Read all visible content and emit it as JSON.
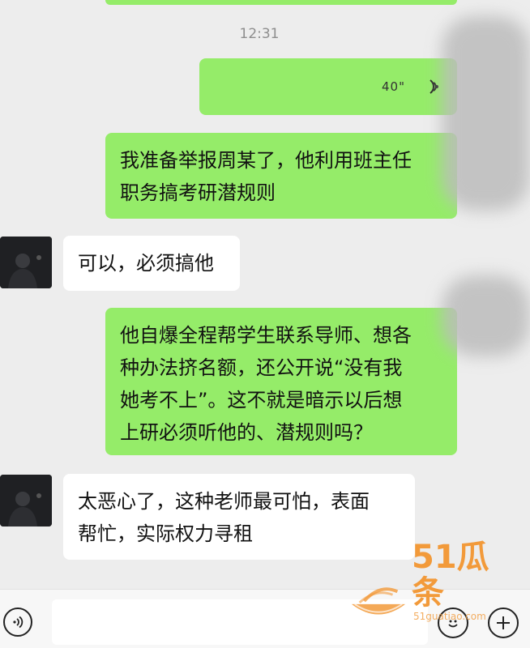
{
  "chat": {
    "timestamp": "12:31",
    "messages": [
      {
        "side": "me",
        "type": "voice",
        "duration": "40\""
      },
      {
        "side": "me",
        "type": "text",
        "text": "我准备举报周某了，他利用班主任\n职务搞考研潜规则"
      },
      {
        "side": "them",
        "type": "text",
        "text": "可以，必须搞他"
      },
      {
        "side": "me",
        "type": "text",
        "text": "他自爆全程帮学生联系导师、想各\n种办法挤名额，还公开说“没有我\n她考不上”。这不就是暗示以后想\n上研必须听他的、潜规则吗？"
      },
      {
        "side": "them",
        "type": "text",
        "text": "太恶心了，这种老师最可怕，表面\n帮忙，实际权力寻租"
      }
    ]
  },
  "input_bar": {
    "voice_icon": "voice-mode-icon",
    "emoji_icon": "emoji-icon",
    "plus_icon": "plus-icon"
  },
  "watermark": {
    "brand": "51瓜条",
    "url": "51guatiao.com"
  },
  "colors": {
    "my_bubble": "#95ec69",
    "their_bubble": "#ffffff",
    "background": "#ededed"
  }
}
